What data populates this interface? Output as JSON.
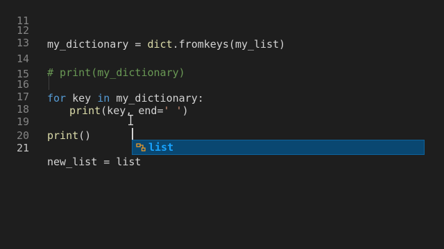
{
  "editor": {
    "lines": [
      {
        "number": "11"
      },
      {
        "number": "12",
        "tokens": [
          "my_dictionary = ",
          "dict",
          ".fromkeys(",
          "my_list",
          ")"
        ]
      },
      {
        "number": "13"
      },
      {
        "number": "14",
        "tokens": [
          "# print(my_dictionary)"
        ]
      },
      {
        "number": "15"
      },
      {
        "number": "16",
        "tokens": [
          "for",
          " key ",
          "in",
          " my_dictionary:"
        ]
      },
      {
        "number": "17",
        "tokens": [
          "print",
          "(key, ",
          "end",
          "=",
          "' '",
          ")"
        ]
      },
      {
        "number": "18"
      },
      {
        "number": "19",
        "tokens": [
          "print",
          "()"
        ]
      },
      {
        "number": "20"
      },
      {
        "number": "21",
        "tokens": [
          "new_list = ",
          "list"
        ]
      }
    ]
  },
  "suggest": {
    "icon": "class-icon",
    "label": "list",
    "match": "list"
  },
  "colors": {
    "background": "#1e1e1e",
    "keyword": "#569cd6",
    "function": "#dcdcaa",
    "string": "#ce9178",
    "comment": "#6a9955",
    "suggest_selected": "#094771"
  }
}
